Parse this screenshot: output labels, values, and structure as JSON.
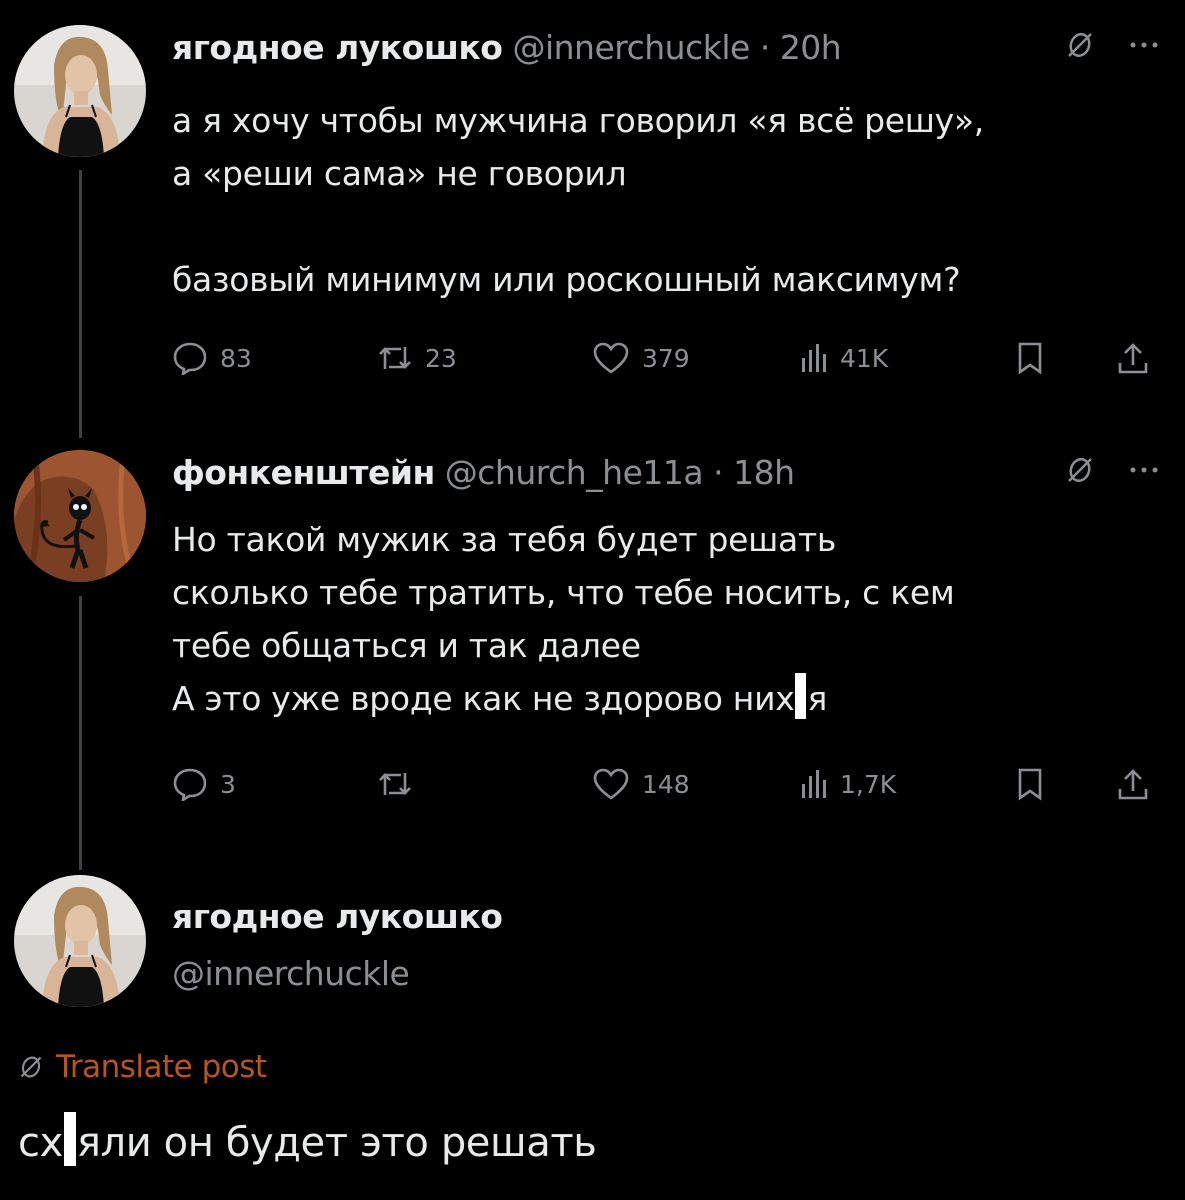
{
  "tweets": [
    {
      "author": "ягодное лукошко",
      "handle": "@innerchuckle",
      "separator": "·",
      "time": "20h",
      "avatar_icon": "woman-portrait-avatar",
      "body": [
        "а я хочу чтобы мужчина говорил «я всё решу»,",
        "а «реши сама» не говорил",
        "",
        "базовый минимум или роскошный максимум?"
      ],
      "actions": {
        "replies": "83",
        "reposts": "23",
        "likes": "379",
        "views": "41K"
      }
    },
    {
      "author": "фонкенштейн",
      "handle": "@church_he11a",
      "separator": "·",
      "time": "18h",
      "avatar_icon": "cartoon-devil-cat-avatar",
      "body": [
        "Но такой мужик за тебя будет решать",
        "сколько тебе тратить, что тебе носить, с кем",
        "тебе общаться и так далее"
      ],
      "body_censored_line": {
        "before": "А это уже вроде как не здорово них",
        "after": "я"
      },
      "actions": {
        "replies": "3",
        "reposts": "",
        "likes": "148",
        "views": "1,7K"
      }
    }
  ],
  "main_post": {
    "author": "ягодное лукошко",
    "handle": "@innerchuckle",
    "translate_label": "Translate post",
    "text_before": "сх",
    "text_after": "яли он будет это решать"
  },
  "colors": {
    "background": "#000000",
    "text": "#e7e9ea",
    "muted": "#8b8f93",
    "translate": "#b6551d",
    "thread_line": "#3e4144"
  },
  "icons": {
    "reply": "speech-bubble-icon",
    "repost": "repost-arrows-icon",
    "like": "heart-icon",
    "views": "bar-chart-icon",
    "bookmark": "bookmark-icon",
    "share": "share-icon",
    "grok": "slashed-circle-icon",
    "more": "more-dots-icon"
  }
}
